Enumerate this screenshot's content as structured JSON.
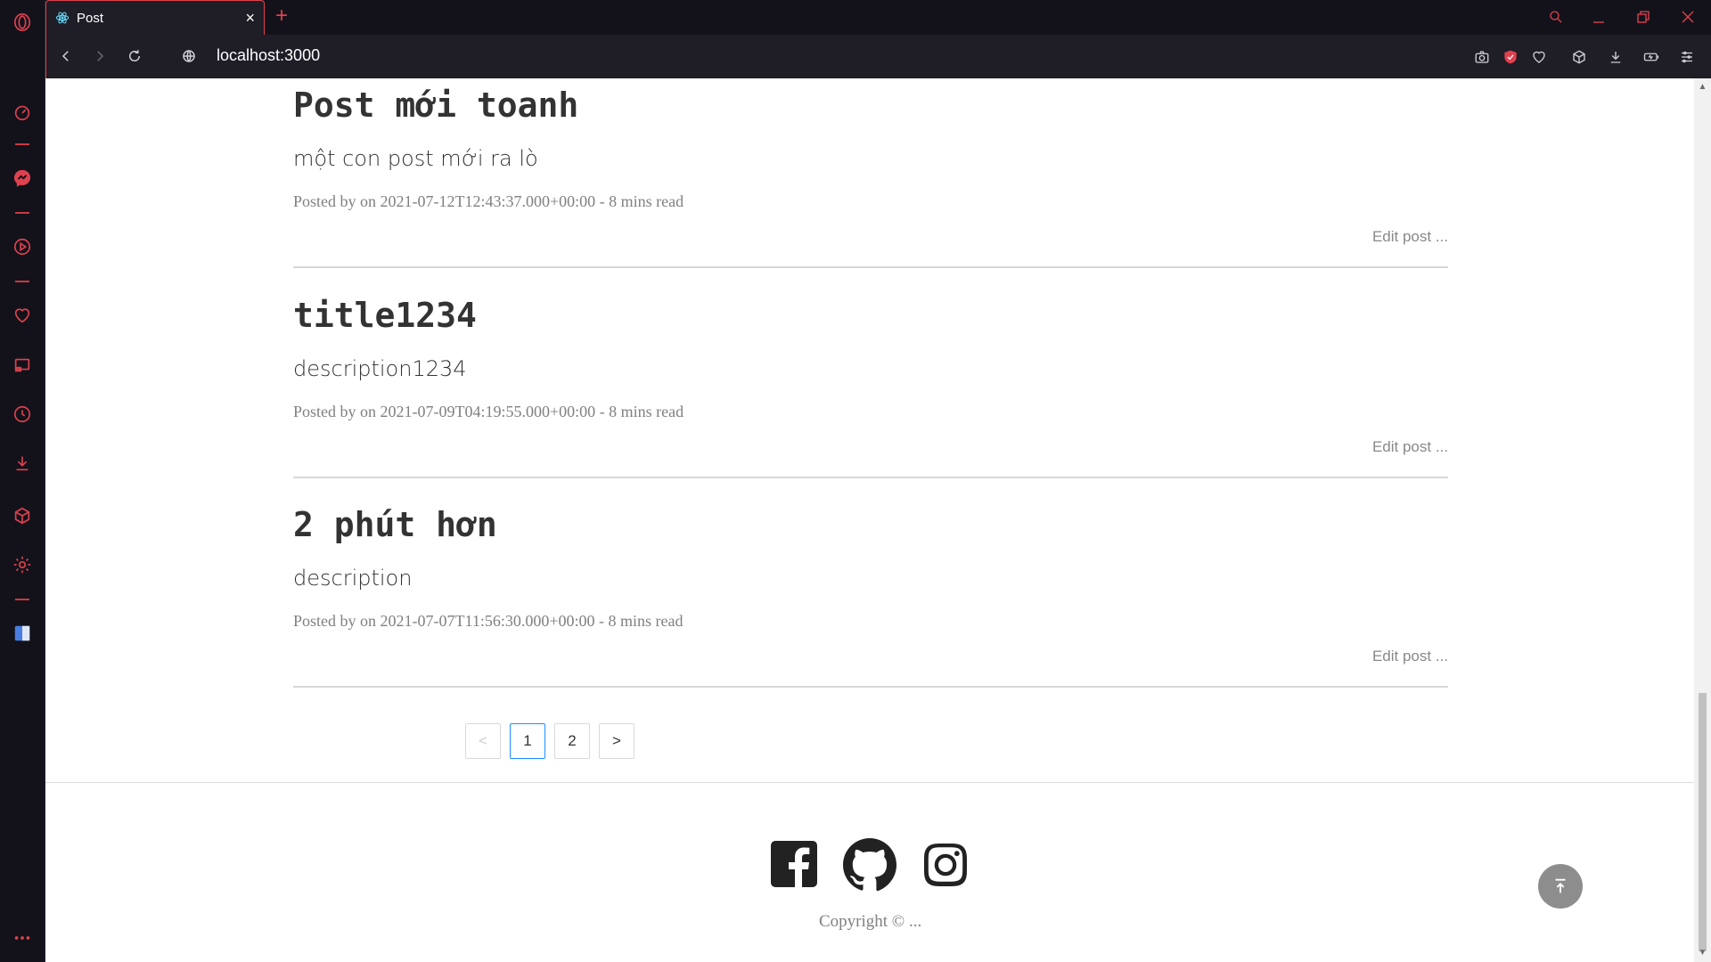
{
  "browser": {
    "tab_title": "Post",
    "url": "localhost:3000",
    "new_tab": "+",
    "close": "×"
  },
  "posts": [
    {
      "title": "Post mới toanh",
      "description": "một con post mới ra lò",
      "meta": "Posted by on 2021-07-12T12:43:37.000+00:00 - 8 mins read",
      "edit": "Edit post ..."
    },
    {
      "title": "title1234",
      "description": "description1234",
      "meta": "Posted by on 2021-07-09T04:19:55.000+00:00 - 8 mins read",
      "edit": "Edit post ..."
    },
    {
      "title": "2 phút hơn",
      "description": "description",
      "meta": "Posted by on 2021-07-07T11:56:30.000+00:00 - 8 mins read",
      "edit": "Edit post ..."
    }
  ],
  "pagination": {
    "prev": "<",
    "pages": [
      "1",
      "2"
    ],
    "current": "1",
    "next": ">"
  },
  "footer": {
    "copyright": "Copyright © ..."
  },
  "colors": {
    "browser_accent": "#e0414f",
    "pagination_active": "#1890ff"
  }
}
